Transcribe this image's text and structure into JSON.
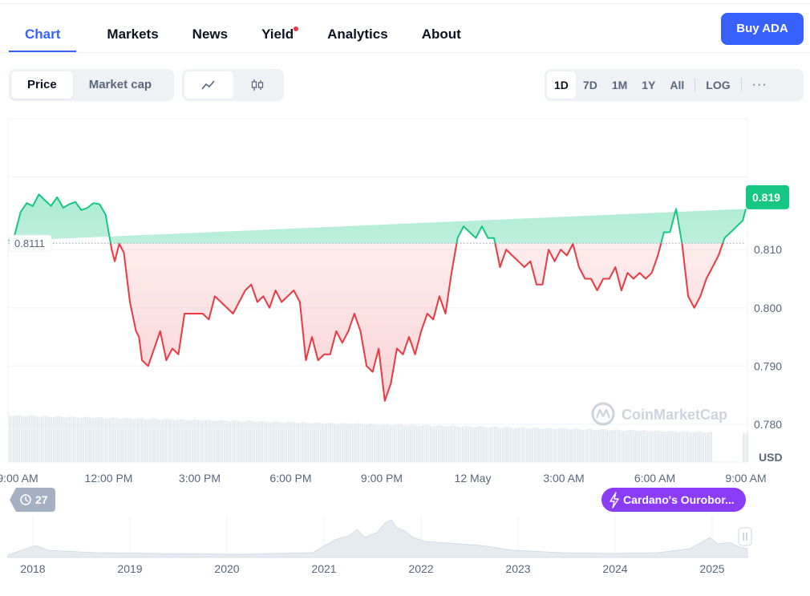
{
  "tabs": [
    {
      "label": "Chart",
      "active": true
    },
    {
      "label": "Markets"
    },
    {
      "label": "News"
    },
    {
      "label": "Yield",
      "badge": true
    },
    {
      "label": "Analytics"
    },
    {
      "label": "About"
    }
  ],
  "buy_button": "Buy ADA",
  "price_toggle": {
    "price": "Price",
    "market_cap": "Market cap"
  },
  "chart_style": {
    "line_icon": "line-chart-icon",
    "candle_icon": "candlestick-icon"
  },
  "ranges": [
    "1D",
    "7D",
    "1M",
    "1Y",
    "All"
  ],
  "log_label": "LOG",
  "more_label": "···",
  "colors": {
    "up": "#16c784",
    "down": "#ea3943",
    "accent": "#3861fb",
    "event": "#8b3cf7"
  },
  "chart_data": {
    "type": "line",
    "currency": "USD",
    "baseline": 0.8111,
    "baseline_label": "0.8111",
    "current_price_label": "0.819",
    "ylim": [
      0.7735,
      0.8325
    ],
    "yticks": [
      0.78,
      0.79,
      0.8,
      0.81
    ],
    "ytick_labels": [
      "0.780",
      "0.790",
      "0.800",
      "0.810"
    ],
    "xtick_labels": [
      "9:00 AM",
      "12:00 PM",
      "3:00 PM",
      "6:00 PM",
      "9:00 PM",
      "12 May",
      "3:00 AM",
      "6:00 AM",
      "9:00 AM"
    ],
    "x_hours": [
      0,
      3,
      6,
      9,
      12,
      15,
      18,
      21,
      24
    ],
    "series": [
      {
        "values_x_hours": [
          -0.3,
          -0.1,
          0.1,
          0.3,
          0.5,
          0.7,
          0.9,
          1.1,
          1.3,
          1.5,
          1.7,
          1.9,
          2.1,
          2.3,
          2.5,
          2.7,
          2.9,
          3.0,
          3.1,
          3.2,
          3.35,
          3.5,
          3.7,
          3.9,
          4.0,
          4.1,
          4.3,
          4.5,
          4.7,
          4.9,
          5.1,
          5.3,
          5.5,
          5.7,
          5.9,
          6.1,
          6.3,
          6.5,
          6.7,
          6.9,
          7.1,
          7.3,
          7.5,
          7.7,
          7.9,
          8.1,
          8.3,
          8.5,
          8.7,
          8.9,
          9.1,
          9.3,
          9.5,
          9.7,
          9.9,
          10.1,
          10.3,
          10.5,
          10.7,
          10.9,
          11.1,
          11.3,
          11.5,
          11.7,
          11.9,
          12.1,
          12.3,
          12.5,
          12.7,
          12.9,
          13.1,
          13.3,
          13.5,
          13.7,
          13.9,
          14.1,
          14.3,
          14.5,
          14.7,
          14.9,
          15.1,
          15.3,
          15.5,
          15.7,
          15.9,
          16.1,
          16.3,
          16.5,
          16.7,
          16.9,
          17.1,
          17.3,
          17.5,
          17.7,
          17.9,
          18.1,
          18.3,
          18.5,
          18.7,
          18.9,
          19.1,
          19.3,
          19.5,
          19.7,
          19.9,
          20.1,
          20.3,
          20.5,
          20.7,
          20.9,
          21.1,
          21.3,
          21.5,
          21.7,
          21.9,
          22.1,
          22.3,
          22.5,
          22.7,
          22.9,
          23.1,
          23.3,
          23.5,
          23.7,
          23.9,
          24.0
        ],
        "values": [
          0.8115,
          0.8125,
          0.8165,
          0.818,
          0.8175,
          0.8195,
          0.8185,
          0.8175,
          0.819,
          0.8172,
          0.8178,
          0.8182,
          0.8168,
          0.8172,
          0.818,
          0.8178,
          0.816,
          0.813,
          0.81,
          0.808,
          0.811,
          0.8095,
          0.801,
          0.796,
          0.795,
          0.791,
          0.79,
          0.793,
          0.796,
          0.791,
          0.793,
          0.792,
          0.799,
          0.799,
          0.799,
          0.799,
          0.798,
          0.802,
          0.801,
          0.8,
          0.799,
          0.801,
          0.803,
          0.804,
          0.801,
          0.802,
          0.8,
          0.803,
          0.801,
          0.802,
          0.803,
          0.801,
          0.791,
          0.795,
          0.791,
          0.792,
          0.792,
          0.796,
          0.794,
          0.796,
          0.799,
          0.796,
          0.79,
          0.789,
          0.793,
          0.784,
          0.787,
          0.793,
          0.792,
          0.795,
          0.792,
          0.796,
          0.799,
          0.798,
          0.802,
          0.799,
          0.806,
          0.812,
          0.814,
          0.813,
          0.812,
          0.814,
          0.812,
          0.812,
          0.807,
          0.81,
          0.809,
          0.808,
          0.807,
          0.808,
          0.804,
          0.804,
          0.81,
          0.808,
          0.81,
          0.809,
          0.811,
          0.807,
          0.805,
          0.805,
          0.803,
          0.805,
          0.805,
          0.807,
          0.803,
          0.806,
          0.805,
          0.806,
          0.805,
          0.806,
          0.809,
          0.813,
          0.813,
          0.817,
          0.811,
          0.802,
          0.8,
          0.802,
          0.805,
          0.807,
          0.809,
          0.812,
          0.813,
          0.814,
          0.815,
          0.817,
          0.819
        ]
      }
    ],
    "volume_label": "volume",
    "watermark": "CoinMarketCap",
    "event_badge": "Cardano's Ourobor...",
    "history_badge": "27",
    "navigator_years": [
      "2018",
      "2019",
      "2020",
      "2021",
      "2022",
      "2023",
      "2024",
      "2025"
    ]
  }
}
